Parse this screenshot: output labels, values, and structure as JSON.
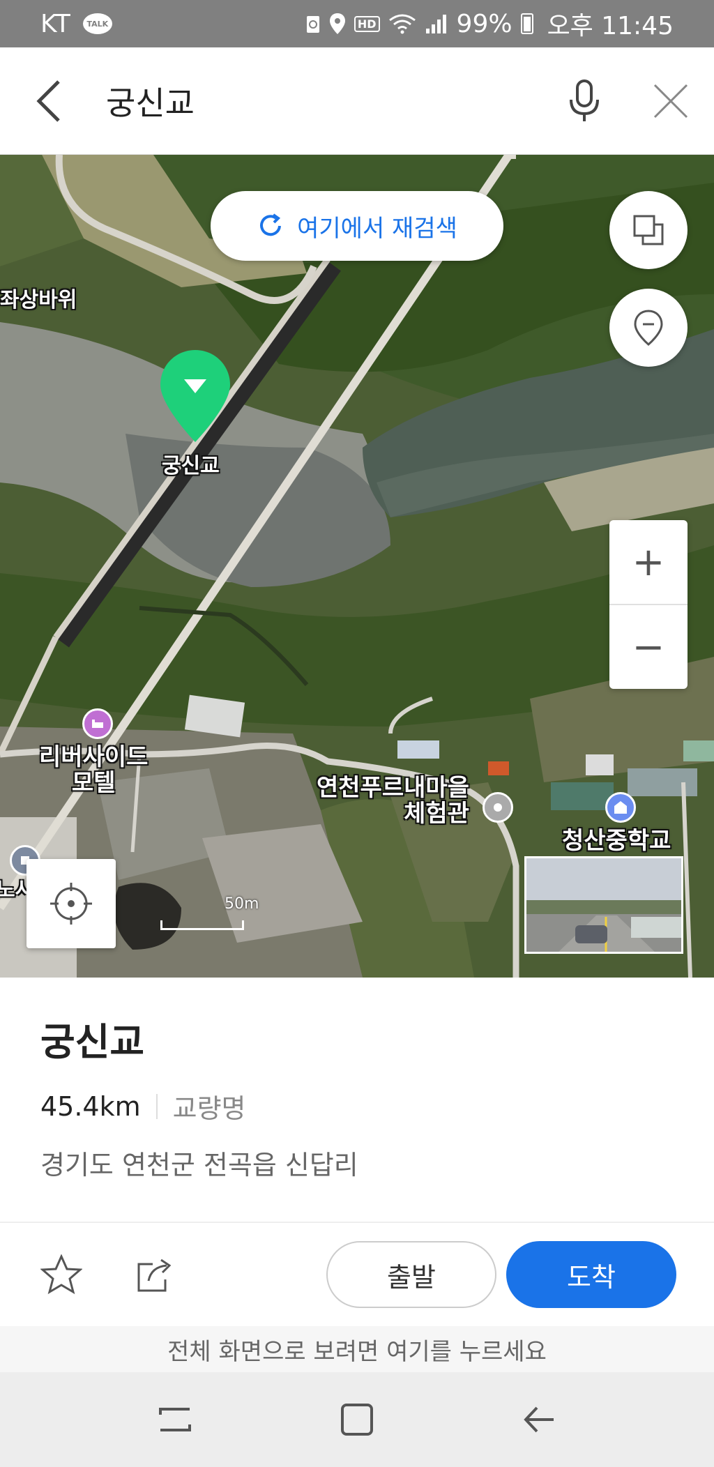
{
  "status_bar": {
    "carrier": "KT",
    "talk_badge": "TALK",
    "hd_label": "HD",
    "battery": "99%",
    "time": "오후 11:45"
  },
  "search": {
    "query": "궁신교"
  },
  "map": {
    "research_button": "여기에서 재검색",
    "labels": {
      "jwasang": "좌상바위",
      "marker_label": "궁신교",
      "riverside_line1": "리버사이드",
      "riverside_line2": "모텔",
      "yeoncheon_line1": "연천푸르내마을",
      "yeoncheon_line2": "체험관",
      "school": "청산중학교",
      "partial_left": "노사"
    },
    "zoom_in": "+",
    "zoom_out": "−",
    "scale_label": "50m",
    "accent_color": "#1a73e8",
    "marker_color": "#1ed07a"
  },
  "place": {
    "name": "궁신교",
    "distance": "45.4km",
    "category": "교량명",
    "address": "경기도 연천군 전곡읍 신답리"
  },
  "actions": {
    "depart": "출발",
    "arrive": "도착"
  },
  "fullscreen_hint": "전체 화면으로 보려면 여기를 누르세요"
}
